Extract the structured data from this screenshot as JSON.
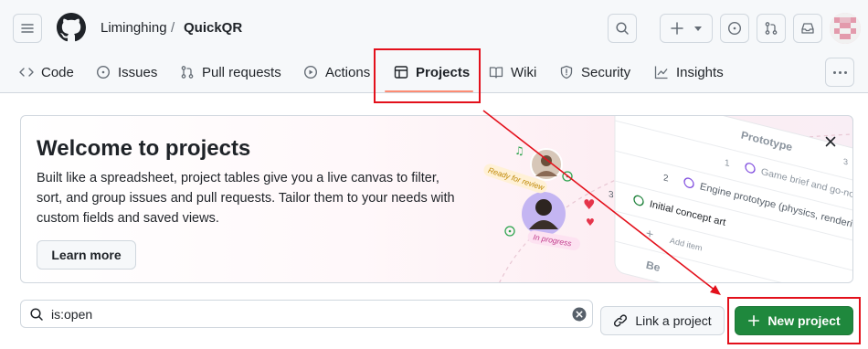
{
  "header": {
    "owner": "Liminghing",
    "separator": "/",
    "repo": "QuickQR"
  },
  "tabs": [
    {
      "label": "Code",
      "icon": "code-icon"
    },
    {
      "label": "Issues",
      "icon": "issue-opened-icon"
    },
    {
      "label": "Pull requests",
      "icon": "git-pull-request-icon"
    },
    {
      "label": "Actions",
      "icon": "play-icon"
    },
    {
      "label": "Projects",
      "icon": "table-icon",
      "active": true
    },
    {
      "label": "Wiki",
      "icon": "book-icon"
    },
    {
      "label": "Security",
      "icon": "shield-icon"
    },
    {
      "label": "Insights",
      "icon": "graph-icon"
    }
  ],
  "banner": {
    "title": "Welcome to projects",
    "description": "Built like a spreadsheet, project tables give you a live canvas to filter, sort, and group issues and pull requests. Tailor them to your needs with custom fields and saved views.",
    "learn_more": "Learn more",
    "illustration": {
      "group_label": "Prototype",
      "group_count": "3",
      "row1_num": "1",
      "row1_text": "Game brief and go-no",
      "row2_num": "2",
      "row2_text": "Engine prototype (physics, renderi",
      "row3_num": "3",
      "row3_text": "Initial concept art",
      "add_item": "Add item",
      "next_group": "Be",
      "tag_ready": "Ready for review",
      "tag_progress": "In progress"
    }
  },
  "filter": {
    "value": "is:open"
  },
  "buttons": {
    "link_project": "Link a project",
    "new_project": "New project"
  },
  "colors": {
    "primary_green": "#1f883d",
    "annotation_red": "#e3101b",
    "tab_underline": "#fd8c73"
  }
}
